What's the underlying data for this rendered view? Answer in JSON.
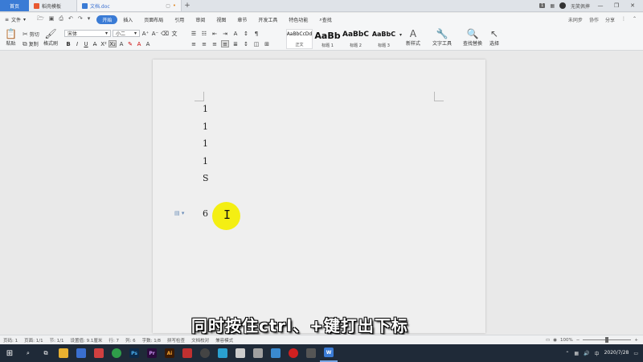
{
  "titlebar": {
    "home_tab": "首页",
    "tabs": [
      {
        "label": "稻壳模板",
        "color": "#e8572e"
      },
      {
        "label": "文档.doc",
        "color": "#3a7bd5"
      }
    ],
    "new_tab": "+",
    "badge": "1",
    "user": "无笑佩摔",
    "window_controls": [
      "—",
      "❐",
      "✕"
    ]
  },
  "menubar": {
    "file": "文件",
    "items": [
      "开始",
      "插入",
      "页面布局",
      "引用",
      "审阅",
      "视图",
      "章节",
      "开发工具",
      "特色功能"
    ],
    "active": "开始",
    "search": "查找",
    "right": [
      "未同步",
      "协作",
      "分享"
    ]
  },
  "ribbon": {
    "paste": "粘贴",
    "cut": "剪切",
    "copy": "复制",
    "format_painter": "格式刷",
    "font_name": "宋体",
    "font_size": "小二",
    "styles": [
      {
        "preview": "AaBbCcDd",
        "label": "正文"
      },
      {
        "preview": "AaBb",
        "label": "标题 1"
      },
      {
        "preview": "AaBbC",
        "label": "标题 2"
      },
      {
        "preview": "AaBbC",
        "label": "标题 3"
      }
    ],
    "new_style": "新样式",
    "text_tool": "文字工具",
    "find_replace": "查找替换",
    "select": "选择"
  },
  "document": {
    "lines": [
      "1",
      "1",
      "1",
      "1",
      "S"
    ],
    "line6_number": "6",
    "ibeam": "I"
  },
  "caption": "同时按住ctrl、+键打出下标",
  "statusbar": {
    "items": [
      "页码: 1",
      "页面: 1/1",
      "节: 1/1",
      "设置值: 9.1厘米",
      "行: 7",
      "列: 6",
      "字数: 1/8",
      "拼写检查",
      "文档校对",
      "兼容模式"
    ],
    "zoom": "100%"
  },
  "taskbar": {
    "apps": [
      {
        "name": "Ps",
        "color": "#0c2a4a"
      },
      {
        "name": "Pr",
        "color": "#2a0a3c"
      },
      {
        "name": "Ai",
        "color": "#3a1a05"
      }
    ],
    "tray_lang": "中",
    "time": "",
    "date": "2020/7/28"
  }
}
